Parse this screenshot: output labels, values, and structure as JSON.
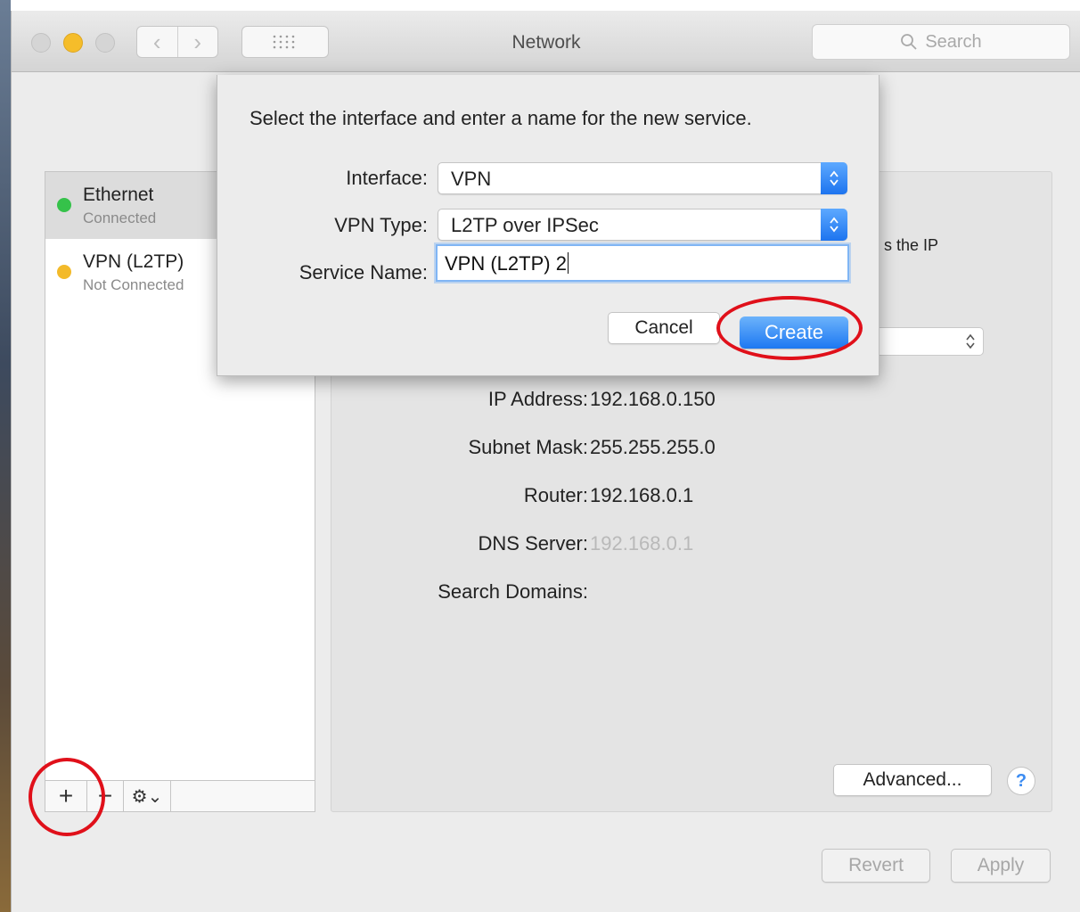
{
  "window": {
    "title": "Network",
    "search_placeholder": "Search"
  },
  "colors": {
    "accent": "#1d78f2",
    "status_connected": "#35c24a",
    "status_not_connected": "#f3ba2a",
    "highlight_ring": "#e0101a"
  },
  "sidebar": {
    "services": [
      {
        "name": "Ethernet",
        "status": "Connected",
        "status_color": "#35c24a",
        "selected": true
      },
      {
        "name": "VPN (L2TP)",
        "status": "Not Connected",
        "status_color": "#f3ba2a",
        "selected": false
      }
    ],
    "toolbar": {
      "add_label": "+",
      "remove_label": "−",
      "gear_menu_label": "⚙⌄",
      "add_icon": "plus-icon",
      "remove_icon": "minus-icon",
      "gear_icon": "gear-icon"
    }
  },
  "detail": {
    "partial_text": "s the IP",
    "fields": [
      {
        "label": "IP Address:",
        "value": "192.168.0.150"
      },
      {
        "label": "Subnet Mask:",
        "value": "255.255.255.0"
      },
      {
        "label": "Router:",
        "value": "192.168.0.1"
      },
      {
        "label": "DNS Server:",
        "value": "192.168.0.1"
      },
      {
        "label": "Search Domains:",
        "value": ""
      }
    ],
    "advanced_label": "Advanced...",
    "help_label": "?"
  },
  "footer": {
    "revert_label": "Revert",
    "apply_label": "Apply"
  },
  "sheet": {
    "title": "Select the interface and enter a name for the new service.",
    "interface_label": "Interface:",
    "interface_value": "VPN",
    "vpn_type_label": "VPN Type:",
    "vpn_type_value": "L2TP over IPSec",
    "service_name_label": "Service Name:",
    "service_name_value": "VPN (L2TP) 2",
    "cancel_label": "Cancel",
    "create_label": "Create"
  }
}
